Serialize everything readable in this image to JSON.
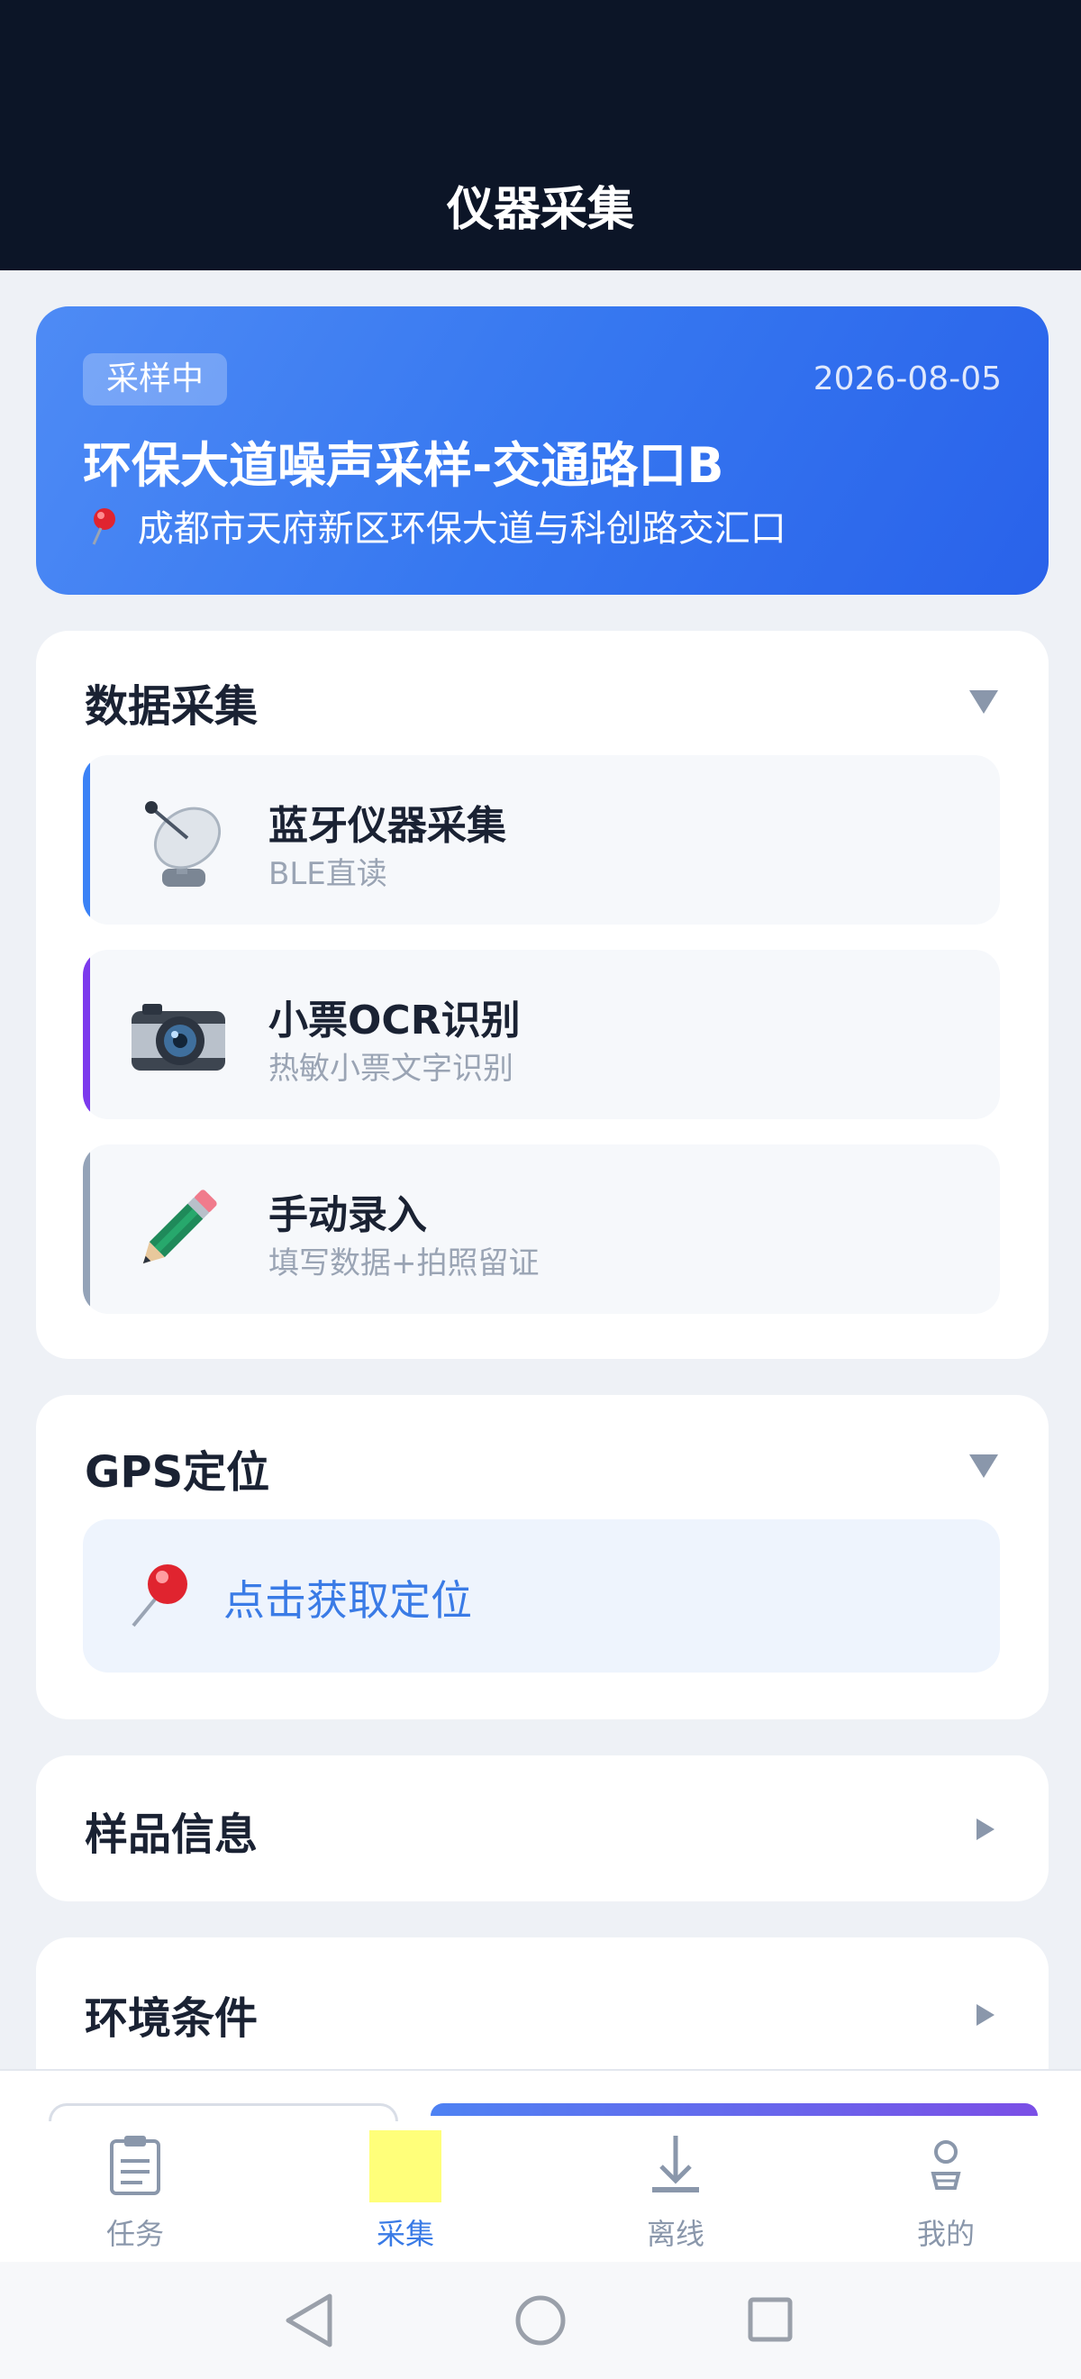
{
  "header": {
    "title": "仪器采集"
  },
  "task": {
    "status": "采样中",
    "date": "2026-08-05",
    "title": "环保大道噪声采样-交通路口B",
    "address": "成都市天府新区环保大道与科创路交汇口"
  },
  "data_collection": {
    "title": "数据采集",
    "methods": [
      {
        "name": "蓝牙仪器采集",
        "desc": "BLE直读",
        "icon": "satellite-dish-icon",
        "accent": "#3b82f6"
      },
      {
        "name": "小票OCR识别",
        "desc": "热敏小票文字识别",
        "icon": "camera-icon",
        "accent": "#7c3aed"
      },
      {
        "name": "手动录入",
        "desc": "填写数据+拍照留证",
        "icon": "pencil-icon",
        "accent": "#94a3b8"
      }
    ]
  },
  "gps": {
    "title": "GPS定位",
    "button_label": "点击获取定位",
    "icon": "pushpin-icon"
  },
  "sample_info": {
    "title": "样品信息"
  },
  "environment": {
    "title": "环境条件"
  },
  "tabs": [
    {
      "label": "任务",
      "icon": "clipboard-icon",
      "active": false
    },
    {
      "label": "采集",
      "icon": "collect-icon",
      "active": true
    },
    {
      "label": "离线",
      "icon": "download-icon",
      "active": false
    },
    {
      "label": "我的",
      "icon": "user-icon",
      "active": false
    }
  ],
  "colors": {
    "header_bg": "#0c1527",
    "accent": "#3a7be6",
    "card_gradient_start": "#4e8bf5",
    "card_gradient_end": "#2962ea"
  }
}
